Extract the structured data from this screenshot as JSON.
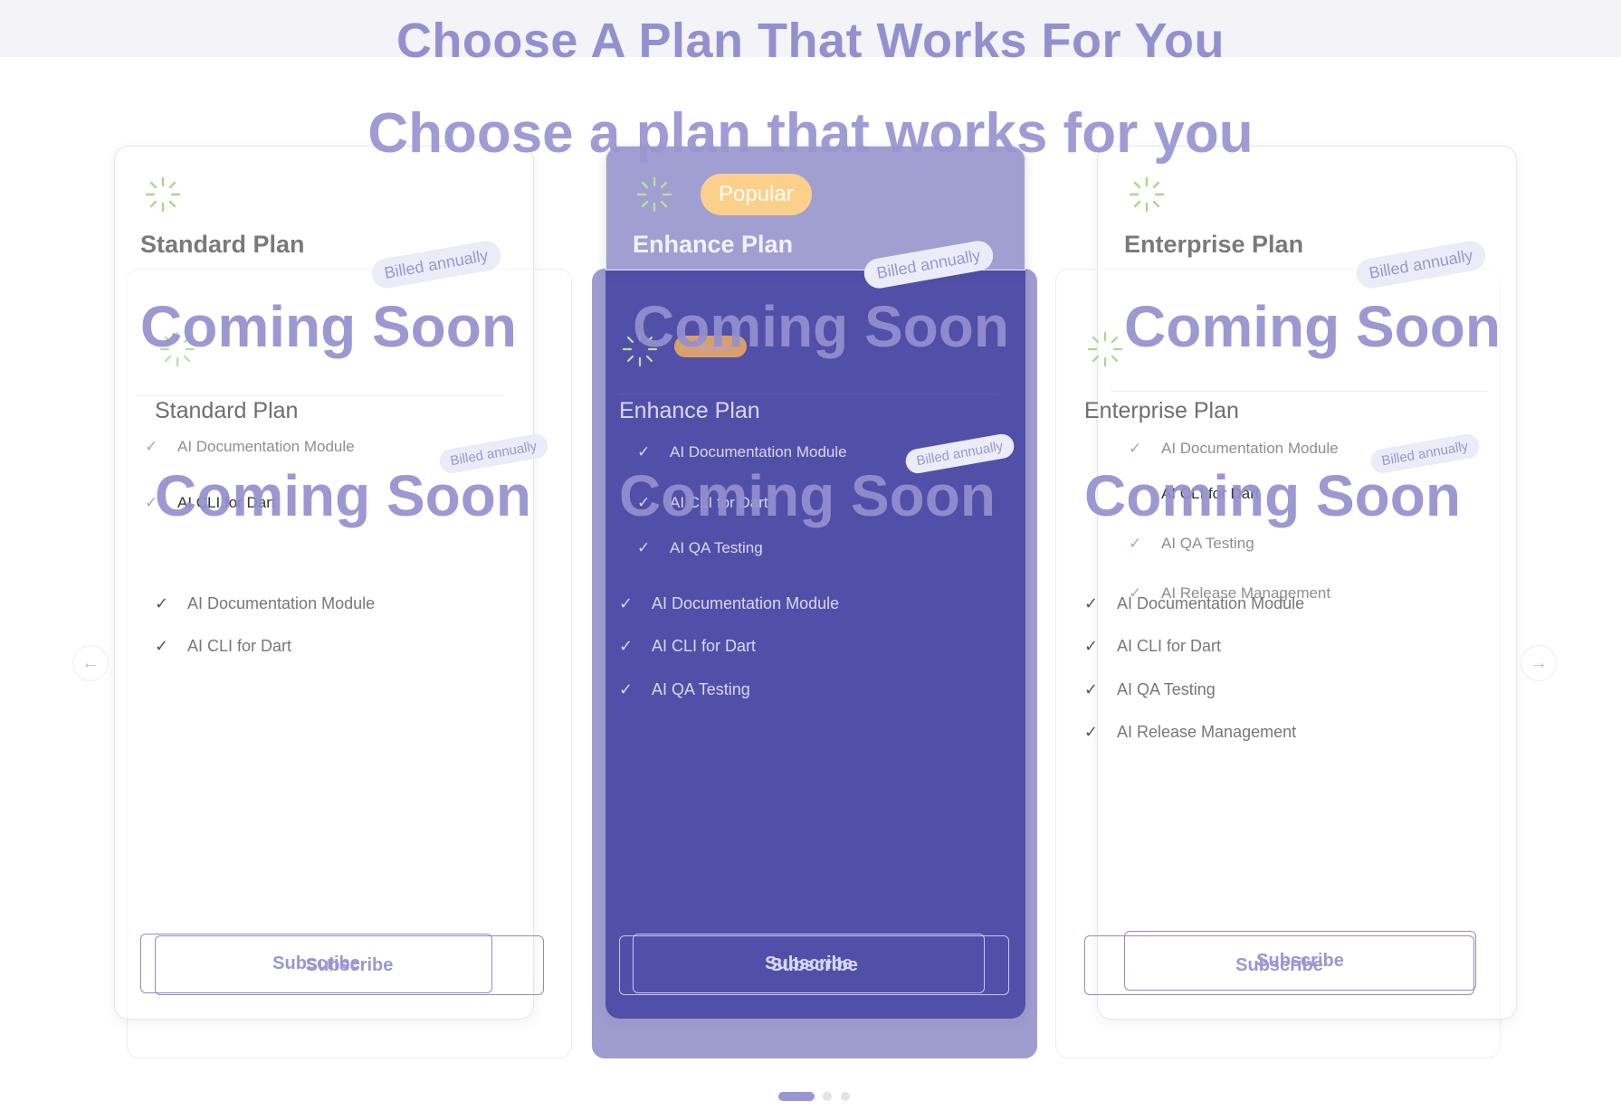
{
  "header": {
    "title_top": "Choose A Plan That Works For You",
    "title_main": "Choose a plan that works for you"
  },
  "common": {
    "billed": "Billed annually",
    "coming_soon": "Coming Soon",
    "subscribe": "Subscribe",
    "popular": "Popular"
  },
  "plans": [
    {
      "name": "Standard Plan",
      "features": [
        "AI Documentation Module",
        "AI CLI for Dart"
      ]
    },
    {
      "name": "Enhance Plan",
      "features": [
        "AI Documentation Module",
        "AI CLI for Dart",
        "AI QA Testing"
      ]
    },
    {
      "name": "Enterprise Plan",
      "features": [
        "AI Documentation Module",
        "AI CLI for Dart",
        "AI QA Testing",
        "AI Release Management"
      ]
    }
  ],
  "nav": {
    "prev_icon": "arrow-left-icon",
    "next_icon": "arrow-right-icon"
  },
  "colors": {
    "accent": "#9a96d3",
    "popular_card": "#3c3a9e",
    "popular_badge": "#fcd08a",
    "sparkle": "#a8d88a"
  }
}
